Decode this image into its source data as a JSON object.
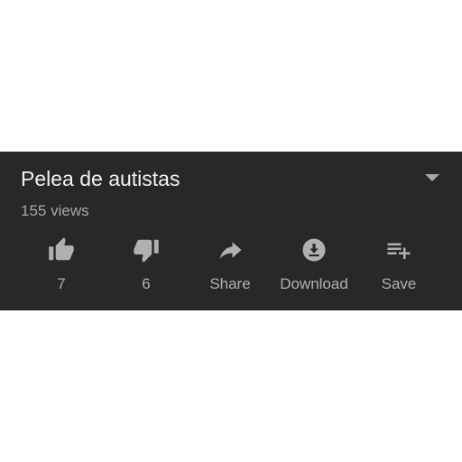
{
  "video": {
    "title": "Pelea de autistas",
    "views": "155 views",
    "expand_icon": "chevron-down-icon"
  },
  "actions": {
    "like": {
      "label": "7",
      "icon": "thumbs-up-icon"
    },
    "dislike": {
      "label": "6",
      "icon": "thumbs-down-icon"
    },
    "share": {
      "label": "Share",
      "icon": "share-icon"
    },
    "download": {
      "label": "Download",
      "icon": "download-icon"
    },
    "save": {
      "label": "Save",
      "icon": "playlist-add-icon"
    }
  },
  "colors": {
    "panel_background": "#282828",
    "title_text": "#f1f1f1",
    "secondary_text": "#a8a8a8",
    "icon": "#b0b0b0"
  }
}
